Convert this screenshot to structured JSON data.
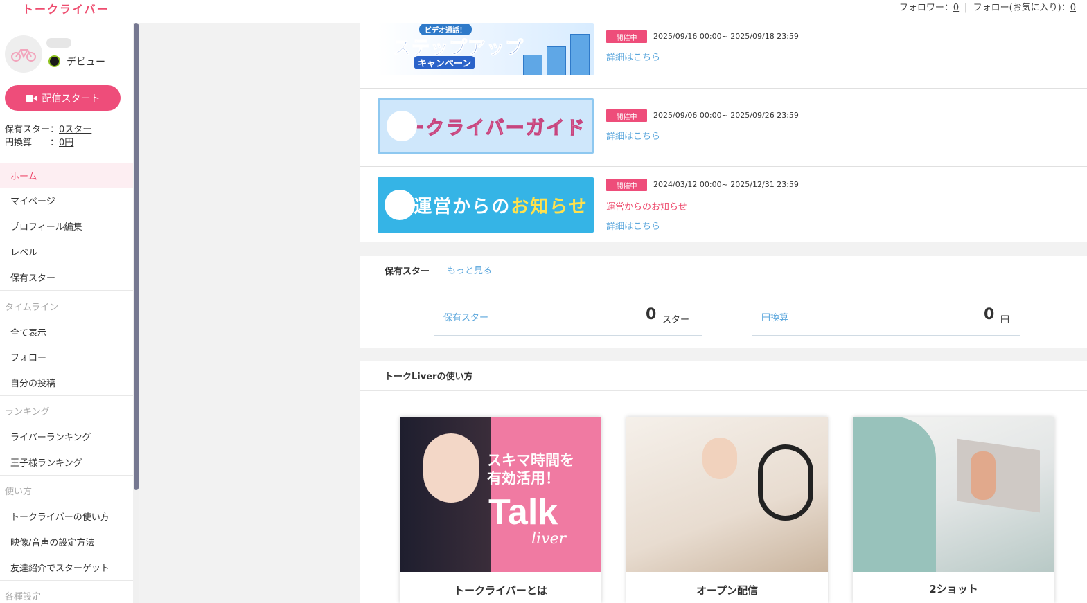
{
  "header": {
    "logo": "トークライバー",
    "followers_label": "フォロワー：",
    "followers_count": "0",
    "following_label": "フォロー(お気に入り)：",
    "following_count": "0",
    "separator": "|"
  },
  "sidebar": {
    "rank": "デビュー",
    "start_button": "配信スタート",
    "stars_label": "保有スター：",
    "stars_value": "0スター",
    "yen_label": "円換算　　：",
    "yen_value": "0円",
    "nav_main": [
      {
        "label": "ホーム",
        "active": true
      },
      {
        "label": "マイページ"
      },
      {
        "label": "プロフィール編集"
      },
      {
        "label": "レベル"
      },
      {
        "label": "保有スター"
      }
    ],
    "section_timeline": "タイムライン",
    "nav_timeline": [
      {
        "label": "全て表示"
      },
      {
        "label": "フォロー"
      },
      {
        "label": "自分の投稿"
      }
    ],
    "section_ranking": "ランキング",
    "nav_ranking": [
      {
        "label": "ライバーランキング"
      },
      {
        "label": "王子様ランキング"
      }
    ],
    "section_howto": "使い方",
    "nav_howto": [
      {
        "label": "トークライバーの使い方"
      },
      {
        "label": "映像/音声の設定方法"
      },
      {
        "label": "友達紹介でスターゲット"
      }
    ],
    "section_settings": "各種設定"
  },
  "campaigns": [
    {
      "status": "開催中",
      "period": "2025/09/16 00:00~ 2025/09/18 23:59",
      "detail": "詳細はこちら",
      "banner_tag": "ビデオ通話！",
      "banner_title": "ステップアップ",
      "banner_sub": "キャンペーン"
    },
    {
      "status": "開催中",
      "period": "2025/09/06 00:00~ 2025/09/26 23:59",
      "detail": "詳細はこちら",
      "banner_title": "トークライバーガイド"
    },
    {
      "status": "開催中",
      "period": "2024/03/12 00:00~ 2025/12/31 23:59",
      "notice": "運営からのお知らせ",
      "detail": "詳細はこちら",
      "banner_title_a": "運営からの",
      "banner_title_b": "お知らせ"
    }
  ],
  "stars_panel": {
    "title": "保有スター",
    "more": "もっと見る",
    "stars_label": "保有スター",
    "stars_value": "0",
    "stars_unit": "スター",
    "yen_label": "円換算",
    "yen_value": "0",
    "yen_unit": "円"
  },
  "howto_panel": {
    "title": "トークLiverの使い方",
    "cards": [
      {
        "title": "トークライバーとは",
        "img_text1": "スキマ時間を",
        "img_text2": "有効活用！",
        "img_talk": "Talk",
        "img_liver": "liver"
      },
      {
        "title": "オープン配信"
      },
      {
        "title": "2ショット"
      }
    ]
  },
  "colors": {
    "accent_pink": "#ee4d7a",
    "link_blue": "#5aa6dc",
    "scroll_thumb": "#767891"
  }
}
